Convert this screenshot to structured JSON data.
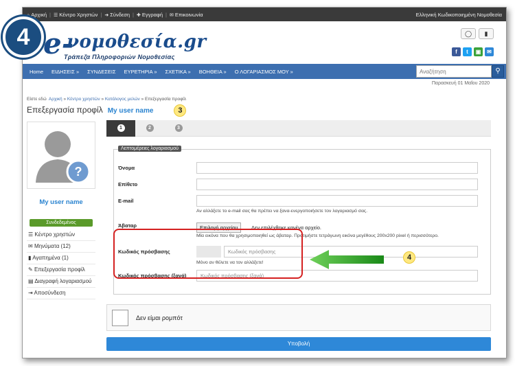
{
  "topbar": {
    "links": [
      "Αρχική",
      "Κέντρο Χρηστών",
      "Σύνδεση",
      "Εγγραφή",
      "Επικοινωνία"
    ],
    "right": "Ελληνική Κωδικοποιημένη Νομοθεσία"
  },
  "header": {
    "logo_main": "νομοθεσία.gr",
    "logo_letter": "e-",
    "logo_sub": "Τράπεζα Πληροφοριών Νομοθεσίας",
    "big_badge": "4"
  },
  "nav": {
    "items": [
      "Home",
      "ΕΙΔΗΣΕΙΣ »",
      "ΣΥΝΔΕΣΕΙΣ",
      "ΕΥΡΕΤΗΡΙΑ »",
      "ΣΧΕΤΙΚΑ »",
      "ΒΟΗΘΕΙΑ »",
      "Ο ΛΟΓΑΡΙΑΣΜΟΣ ΜΟΥ »"
    ],
    "search_placeholder": "Αναζήτηση"
  },
  "date": "Παρασκευή 01 Μαΐου 2020",
  "breadcrumb": {
    "prefix": "Είστε εδώ",
    "items": [
      "Αρχική",
      "Κέντρο χρηστών",
      "Κατάλογος μελών"
    ],
    "current": "Επεξεργασία προφίλ"
  },
  "page": {
    "title": "Επεξεργασία προφίλ",
    "user": "My user name",
    "badge3": "3",
    "badge4": "4"
  },
  "sidebar": {
    "user_name": "My user name",
    "status": "Συνδεδεμένος",
    "items": [
      "Κέντρο χρηστών",
      "Μηνύματα (12)",
      "Αγαπημένα (1)",
      "Επεξεργασία προφίλ",
      "Διαγραφή λογαριασμού",
      "Αποσύνδεση"
    ]
  },
  "steps": [
    "1",
    "2",
    "3"
  ],
  "form": {
    "legend": "Λεπτομέρειες λογαριασμού",
    "first_name": "Όνομα",
    "last_name": "Επίθετο",
    "email": "E-mail",
    "email_help": "Αν αλλάξετε το e-mail σας θα πρέπει να ξανα-ενεργοποιήσετε τον λογαριασμό σας.",
    "avatar": "Άβαταρ",
    "file_button": "Επιλογή αρχείου",
    "file_none": "Δεν επιλέχθηκε κανένα αρχείο.",
    "avatar_help": "Μία εικόνα που θα χρησιμοποιηθεί ως άβαταρ. Προτιμήστε τετράγωνη εικόνα μεγέθους 200x200 pixel ή περισσότερο.",
    "password": "Κωδικός πρόσβασης",
    "password_placeholder": "Κωδικός πρόσβασης",
    "password_help": "Μόνο αν θέλετε να τον αλλάξετε!",
    "password2": "Κωδικός πρόσβασης (ξανά)",
    "password2_placeholder": "Κωδικός πρόσβασης (ξανά)"
  },
  "captcha": "Δεν είμαι ρομπότ",
  "submit": "Υποβολή",
  "colors": {
    "nav": "#3d6fb0",
    "accent": "#2e88d8",
    "highlight": "#d42020",
    "arrow": "#22a21c"
  }
}
